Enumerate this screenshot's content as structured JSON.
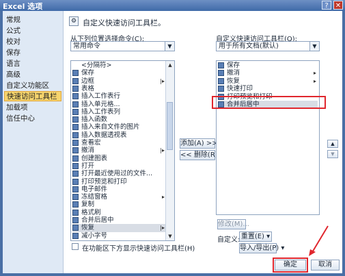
{
  "window": {
    "title": "Excel 选项",
    "help": "?",
    "close": "✕"
  },
  "nav": {
    "items": [
      {
        "label": "常规"
      },
      {
        "label": "公式"
      },
      {
        "label": "校对"
      },
      {
        "label": "保存"
      },
      {
        "label": "语言"
      },
      {
        "label": "高级"
      },
      {
        "label": "自定义功能区"
      },
      {
        "label": "快速访问工具栏",
        "selected": true
      },
      {
        "label": "加载项"
      },
      {
        "label": "信任中心"
      }
    ]
  },
  "heading": {
    "title": "自定义快速访问工具栏。"
  },
  "left": {
    "label": "从下列位置选择命令(C):",
    "combo_value": "常用命令",
    "items": [
      {
        "label": "<分隔符>"
      },
      {
        "label": "保存",
        "icon": "save-icon"
      },
      {
        "label": "边框",
        "icon": "border-icon",
        "arrow": "|▸"
      },
      {
        "label": "表格",
        "icon": "table-icon"
      },
      {
        "label": "插入工作表行",
        "icon": "insert-row-icon"
      },
      {
        "label": "插入单元格...",
        "icon": "insert-cell-icon"
      },
      {
        "label": "插入工作表列",
        "icon": "insert-column-icon"
      },
      {
        "label": "插入函数",
        "icon": "function-icon"
      },
      {
        "label": "插入来自文件的图片",
        "icon": "picture-icon"
      },
      {
        "label": "插入数据透视表",
        "icon": "pivot-table-icon"
      },
      {
        "label": "查看宏",
        "icon": "macro-icon"
      },
      {
        "label": "撤消",
        "icon": "undo-icon",
        "arrow": "|▸"
      },
      {
        "label": "创建图表",
        "icon": "chart-icon"
      },
      {
        "label": "打开",
        "icon": "open-icon"
      },
      {
        "label": "打开最近使用过的文件...",
        "icon": "recent-file-icon"
      },
      {
        "label": "打印预览和打印",
        "icon": "print-preview-icon"
      },
      {
        "label": "电子邮件",
        "icon": "email-icon"
      },
      {
        "label": "冻结窗格",
        "icon": "freeze-panes-icon",
        "arrow": "▸"
      },
      {
        "label": "复制",
        "icon": "copy-icon"
      },
      {
        "label": "格式刷",
        "icon": "format-painter-icon"
      },
      {
        "label": "合并后居中",
        "icon": "merge-center-icon"
      },
      {
        "label": "恢复",
        "icon": "redo-icon",
        "arrow": "|▸",
        "selected": true
      },
      {
        "label": "减小字号",
        "icon": "decrease-font-icon"
      }
    ]
  },
  "right": {
    "label": "自定义快速访问工具栏(Q):",
    "combo_value": "用于所有文档(默认)",
    "items": [
      {
        "label": "保存",
        "icon": "save-icon"
      },
      {
        "label": "撤消",
        "icon": "undo-icon",
        "arrow": "▸"
      },
      {
        "label": "恢复",
        "icon": "redo-icon",
        "arrow": "▸"
      },
      {
        "label": "快速打印",
        "icon": "quick-print-icon"
      },
      {
        "label": "打印预览和打印",
        "icon": "print-preview-icon"
      },
      {
        "label": "合并后居中",
        "icon": "merge-center-icon",
        "selected": true
      }
    ]
  },
  "buttons": {
    "add": "添加(A) >>",
    "remove": "<< 删除(R)",
    "modify": "修改(M)...",
    "move_up": "▲",
    "move_down": "▼",
    "customize_label": "自定义:",
    "reset": "重置(E)",
    "import_export": "导入/导出(P)",
    "ok": "确定",
    "cancel": "取消"
  },
  "checkbox": {
    "label": "在功能区下方显示快速访问工具栏(H)",
    "checked": false
  },
  "colors": {
    "highlight": "#e0262d",
    "nav_selected": "#f6d46d",
    "accent": "#4a6fa5"
  }
}
